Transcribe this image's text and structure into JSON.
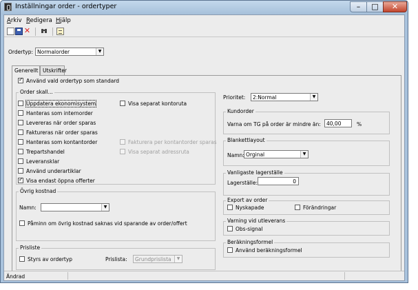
{
  "window": {
    "title": "Inställningar order - ordertyper",
    "minimize_symbol": "–",
    "maximize_symbol": "□",
    "close_symbol": "✕"
  },
  "menu": {
    "items": [
      {
        "mnemonic": "A",
        "rest": "rkiv"
      },
      {
        "mnemonic": "R",
        "rest": "edigera"
      },
      {
        "mnemonic": "H",
        "rest": "jälp"
      }
    ]
  },
  "toolbar": {
    "icons": [
      "new-document-icon",
      "save-icon",
      "delete-icon",
      "find-icon",
      "properties-icon"
    ],
    "delete_glyph": "✕",
    "find_glyph": "🔭"
  },
  "ordertyp": {
    "label": "Ordertyp:",
    "value": "Normalorder",
    "arrow": "▼"
  },
  "tabs": [
    {
      "label": "Generellt",
      "active": true
    },
    {
      "label": "Utskrifter",
      "active": false
    }
  ],
  "general": {
    "use_selected_label": "Använd vald ordertyp som standard",
    "use_selected_checked": true
  },
  "order_skall": {
    "title": "Order skall...",
    "left": [
      {
        "label": "Uppdatera ekonomisystem",
        "checked": false,
        "focused": true
      },
      {
        "label": "Hanteras som internorder",
        "checked": false
      },
      {
        "label": "Levereras när order sparas",
        "checked": false
      },
      {
        "label": "Faktureras när order sparas",
        "checked": false
      },
      {
        "label": "Hanteras som kontantorder",
        "checked": false
      },
      {
        "label": "Trepartshandel",
        "checked": false
      },
      {
        "label": "Leveransklar",
        "checked": false
      },
      {
        "label": "Använd underartiklar",
        "checked": false
      },
      {
        "label": "Visa endast öppna offerter",
        "checked": true
      }
    ],
    "right": [
      {
        "label": "Visa separat kontoruta",
        "checked": false,
        "disabled": false
      },
      {
        "label": "Fakturera per kontantorder sparas",
        "checked": false,
        "disabled": true
      },
      {
        "label": "Visa separat adressruta",
        "checked": false,
        "disabled": true
      }
    ]
  },
  "ovrig_kostnad": {
    "title": "Övrig kostnad",
    "name_label": "Namn:",
    "name_value": "",
    "reminder_label": "Påminn om övrig kostnad saknas vid sparande av order/offert",
    "reminder_checked": false
  },
  "prisliste": {
    "title": "Prisliste",
    "styrs_label": "Styrs av ordertyp",
    "styrs_checked": false,
    "prislista_label": "Prislista:",
    "prislista_value": "Grundprislista"
  },
  "prioritet": {
    "label": "Prioritet:",
    "value": "2:Normal"
  },
  "kundorder": {
    "title": "Kundorder",
    "varna_label": "Varna om TG på order är mindre än:",
    "varna_value": "40,00",
    "unit": "%"
  },
  "blankettlayout": {
    "title": "Blankettlayout",
    "name_label": "Namn:",
    "name_value": "Orginal"
  },
  "vanligaste_lagerstalle": {
    "title": "Vanligaste lagerställe",
    "label": "Lagerställe:",
    "value": "0"
  },
  "export_av_order": {
    "title": "Export av order",
    "nyskapade_label": "Nyskapade",
    "nyskapade_checked": false,
    "forandringar_label": "Förändringar",
    "forandringar_checked": false
  },
  "varning_vid_utleverans": {
    "title": "Varning vid utleverans",
    "obs_label": "Obs-signal",
    "obs_checked": false
  },
  "berakningsformel": {
    "title": "Beräkningsformel",
    "label": "Använd beräkningsformel",
    "checked": false
  },
  "status": {
    "text": "Ändrad"
  },
  "colors": {
    "titlebar": "#b5cde4",
    "close_button": "#c2452d",
    "client_bg": "#ececec"
  }
}
